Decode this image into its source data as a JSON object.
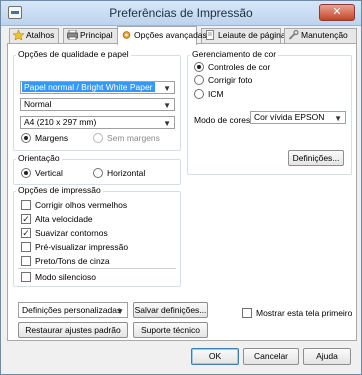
{
  "window": {
    "title": "Preferências de Impressão",
    "close_label": "✕"
  },
  "tabs": [
    {
      "label": "Atalhos",
      "icon": "star-icon"
    },
    {
      "label": "Principal",
      "icon": "printer-icon"
    },
    {
      "label": "Opções avançadas",
      "icon": "settings-icon"
    },
    {
      "label": "Leiaute de página",
      "icon": "page-icon"
    },
    {
      "label": "Manutenção",
      "icon": "wrench-icon"
    }
  ],
  "quality": {
    "group_label": "Opções de qualidade e papel",
    "paper_type": "Papel normal / Bright White Paper",
    "quality": "Normal",
    "paper_size": "A4 (210 x 297 mm)",
    "margins_label": "Margens",
    "no_margins_label": "Sem margens"
  },
  "orientation": {
    "group_label": "Orientação",
    "vertical": "Vertical",
    "horizontal": "Horizontal"
  },
  "print_options": {
    "group_label": "Opções de impressão",
    "items": [
      {
        "label": "Corrigir olhos vermelhos",
        "checked": false
      },
      {
        "label": "Alta velocidade",
        "checked": true
      },
      {
        "label": "Suavizar contornos",
        "checked": true
      },
      {
        "label": "Pré-visualizar impressão",
        "checked": false
      },
      {
        "label": "Preto/Tons de cinza",
        "checked": false
      },
      {
        "label": "Modo silencioso",
        "checked": false
      }
    ]
  },
  "color_mgmt": {
    "group_label": "Gerenciamento de cor",
    "opt1": "Controles de cor",
    "opt2": "Corrigir foto",
    "opt3": "ICM",
    "mode_label": "Modo de cores",
    "mode_value": "Cor vívida EPSON",
    "settings_button": "Definições..."
  },
  "bottom": {
    "custom_select": "Definições personalizadas",
    "save_button": "Salvar definições...",
    "restore_button": "Restaurar ajustes padrão",
    "support_button": "Suporte técnico",
    "show_first_label": "Mostrar esta tela primeiro"
  },
  "footer": {
    "ok": "OK",
    "cancel": "Cancelar",
    "help": "Ajuda"
  },
  "colors": {
    "accent": "#3399ff",
    "titlebar": "#c9ddf2"
  }
}
